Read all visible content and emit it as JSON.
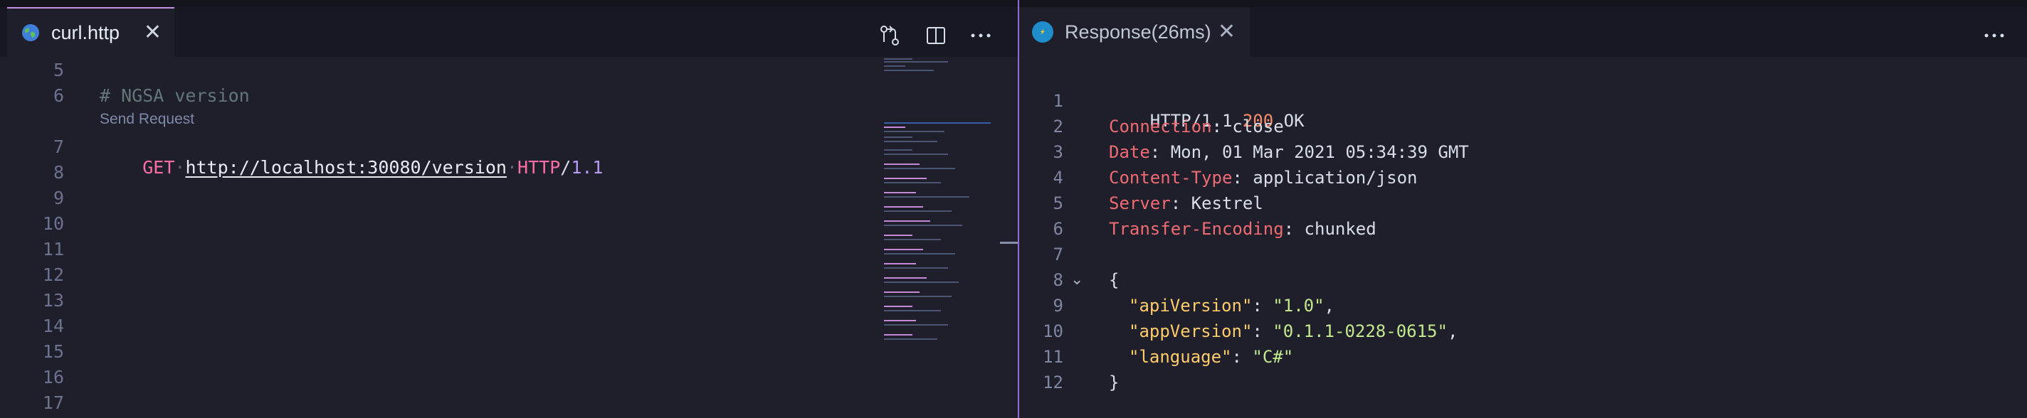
{
  "left_editor": {
    "tab": {
      "label": "curl.http",
      "icon": "globe-icon"
    },
    "actions": [
      "open-changes-icon",
      "split-editor-icon",
      "more-actions-icon"
    ],
    "codelens": "Send Request",
    "lines": [
      {
        "num": "5",
        "comment": ""
      },
      {
        "num": "6",
        "comment": "# NGSA version"
      },
      {
        "num": "7",
        "method": "GET",
        "url": "http://localhost:30080/version",
        "proto": "HTTP",
        "slash": "/",
        "ver": "1.1"
      },
      {
        "num": "8"
      },
      {
        "num": "9"
      },
      {
        "num": "10"
      },
      {
        "num": "11"
      },
      {
        "num": "12"
      },
      {
        "num": "13"
      },
      {
        "num": "14"
      },
      {
        "num": "15"
      },
      {
        "num": "16"
      },
      {
        "num": "17"
      }
    ]
  },
  "right_editor": {
    "tab": {
      "label": "Response(26ms)",
      "icon": "rest-client-badge-icon"
    },
    "lines": [
      {
        "num": "1",
        "a": "HTTP/1.1 ",
        "b": "200",
        "c": " OK"
      },
      {
        "num": "2",
        "key": "Connection",
        "val": ": close"
      },
      {
        "num": "3",
        "key": "Date",
        "val": ": Mon, 01 Mar 2021 05:34:39 GMT"
      },
      {
        "num": "4",
        "key": "Content-Type",
        "val": ": application/json"
      },
      {
        "num": "5",
        "key": "Server",
        "val": ": Kestrel"
      },
      {
        "num": "6",
        "key": "Transfer-Encoding",
        "val": ": chunked"
      },
      {
        "num": "7"
      },
      {
        "num": "8",
        "text": "{"
      },
      {
        "num": "9",
        "jkey": "\"apiVersion\"",
        "sep": ": ",
        "jval": "\"1.0\"",
        "end": ","
      },
      {
        "num": "10",
        "jkey": "\"appVersion\"",
        "sep": ": ",
        "jval": "\"0.1.1-0228-0615\"",
        "end": ","
      },
      {
        "num": "11",
        "jkey": "\"language\"",
        "sep": ": ",
        "jval": "\"C#\"",
        "end": ""
      },
      {
        "num": "12",
        "text": "}"
      }
    ]
  },
  "colors": {
    "accent": "#c792ea",
    "divider": "#8f6fd6",
    "badge": "#1e8dc9"
  }
}
